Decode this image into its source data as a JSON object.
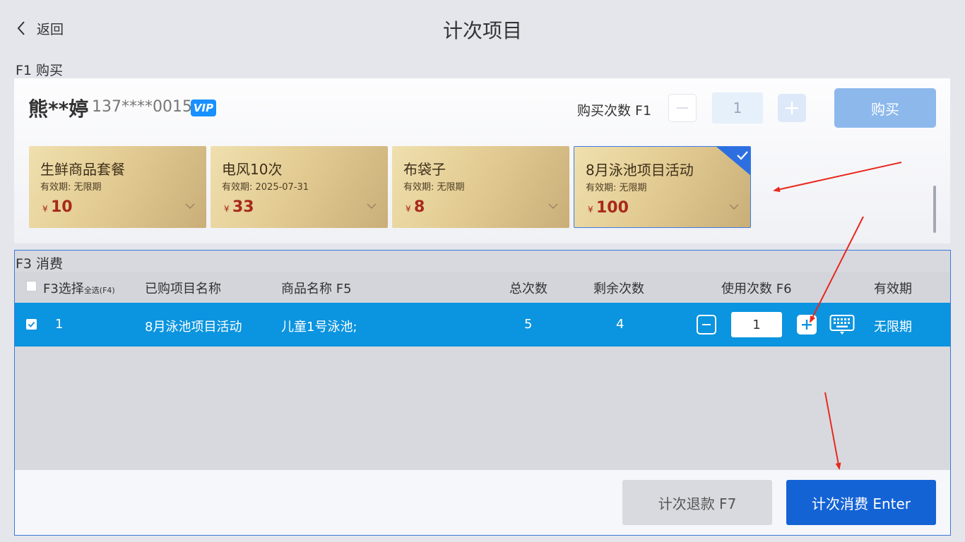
{
  "header": {
    "back_label": "返回",
    "title": "计次项目"
  },
  "purchase": {
    "section_label": "F1 购买",
    "customer": {
      "name": "熊**婷",
      "phone": "137****0015",
      "badge": "VIP"
    },
    "quantity_label": "购买次数 F1",
    "quantity": "1",
    "buy_label": "购买",
    "currency": "¥",
    "cards": [
      {
        "name": "生鲜商品套餐",
        "validity": "有效期: 无限期",
        "price": "10",
        "selected": false
      },
      {
        "name": "电风10次",
        "validity": "有效期: 2025-07-31",
        "price": "33",
        "selected": false
      },
      {
        "name": "布袋子",
        "validity": "有效期: 无限期",
        "price": "8",
        "selected": false
      },
      {
        "name": "8月泳池项目活动",
        "validity": "有效期: 无限期",
        "price": "100",
        "selected": true
      }
    ]
  },
  "consume": {
    "section_label": "F3 消费",
    "columns": {
      "select": "F3选择",
      "select_all": "全选(F4)",
      "item_name": "已购项目名称",
      "product_name": "商品名称 F5",
      "total": "总次数",
      "remaining": "剩余次数",
      "use_count": "使用次数 F6",
      "validity": "有效期"
    },
    "rows": [
      {
        "index": "1",
        "item_name": "8月泳池项目活动",
        "product_name": "儿童1号泳池;",
        "total": "5",
        "remaining": "4",
        "use_count": "1",
        "validity": "无限期",
        "checked": true
      }
    ],
    "refund_label": "计次退款 F7",
    "consume_label": "计次消费 Enter"
  },
  "colors": {
    "primary": "#1463d5",
    "row_highlight": "#0b94df",
    "card_gold": "#e3cc93",
    "annotation": "#e8281e"
  }
}
